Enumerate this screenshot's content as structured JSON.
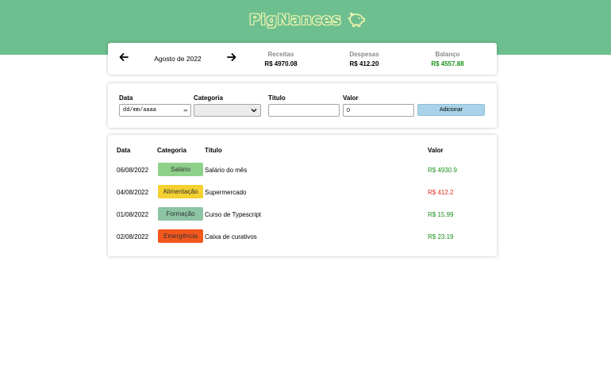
{
  "app": {
    "name": "PigNances",
    "logo_icon": "piggy-bank-icon",
    "brand_color": "#6dbf8f",
    "logo_color": "#f6f7b0"
  },
  "summary": {
    "month": "Agosto de 2022",
    "prev_icon": "arrow-left-icon",
    "next_icon": "arrow-right-icon",
    "income": {
      "label": "Receitas",
      "value": "R$ 4970.08",
      "color": "#000000"
    },
    "expenses": {
      "label": "Despesas",
      "value": "R$ 412.20",
      "color": "#000000"
    },
    "balance": {
      "label": "Balanço",
      "value": "R$ 4557.88",
      "color": "#1a8f1a"
    }
  },
  "form": {
    "date_label": "Data",
    "date_placeholder": "dd/mm/aaaa",
    "category_label": "Categoria",
    "category_value": "",
    "title_label": "Título",
    "title_value": "",
    "value_label": "Valor",
    "value_value": "0",
    "add_button": "Adicionar"
  },
  "table": {
    "headers": {
      "date": "Data",
      "category": "Categoria",
      "title": "Título",
      "value": "Valor"
    },
    "rows": [
      {
        "date": "06/08/2022",
        "category": "Salário",
        "category_color": "#8fd18b",
        "title": "Salário do mês",
        "value": "R$ 4930.9",
        "value_color": "#1a8f1a"
      },
      {
        "date": "04/08/2022",
        "category": "Alimentação",
        "category_color": "#f5d130",
        "title": "Supermercado",
        "value": "R$ 412.2",
        "value_color": "#e0281c"
      },
      {
        "date": "01/08/2022",
        "category": "Formação",
        "category_color": "#8cc4a4",
        "title": "Curso de Typescript",
        "value": "R$ 15.99",
        "value_color": "#1a8f1a"
      },
      {
        "date": "02/08/2022",
        "category": "Emergência",
        "category_color": "#f2571d",
        "title": "Caixa de curativos",
        "value": "R$ 23.19",
        "value_color": "#1a8f1a"
      }
    ]
  }
}
